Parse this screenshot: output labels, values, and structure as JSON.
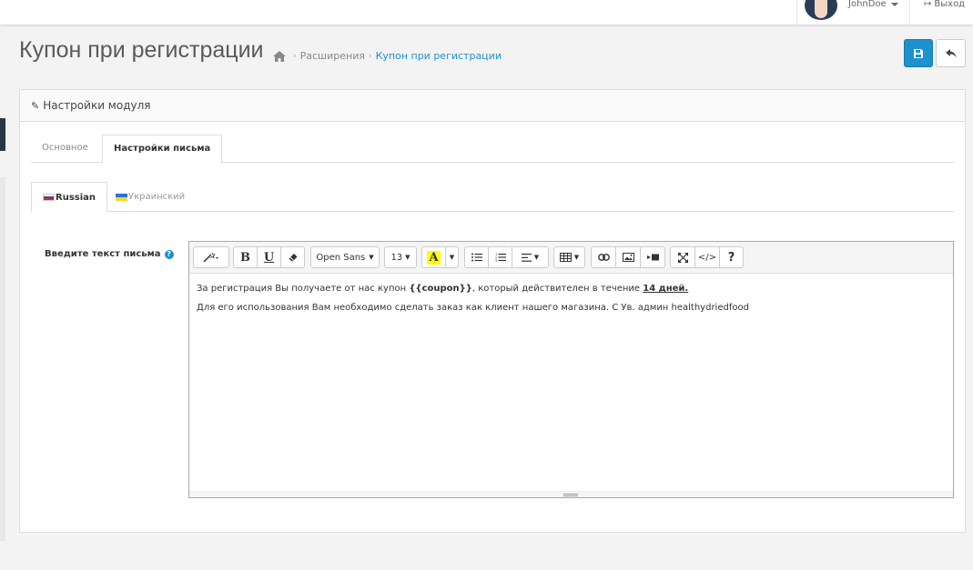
{
  "topbar": {
    "username": "JohnDoe",
    "logout_label": "Выход"
  },
  "header": {
    "title": "Купон при регистрации",
    "breadcrumb": [
      "Расширения",
      "Купон при регистрации"
    ]
  },
  "panel": {
    "heading": "Настройки модуля",
    "tabs": [
      "Основное",
      "Настройки письма"
    ],
    "active_tab": "Настройки письма",
    "language_tabs": [
      "Russian",
      "Украинский"
    ],
    "active_language": "Russian"
  },
  "form": {
    "label": "Введите текст письма",
    "help_icon": "question-circle-icon"
  },
  "editor": {
    "font_family": "Open Sans",
    "font_size": "13",
    "line1_part1": "За регистрация Вы получаете от нас купон ",
    "line1_coupon": "{{coupon}}",
    "line1_part2": ", который действителен в течение ",
    "line1_days": "14 дней.",
    "line2": "Для его использования Вам необходимо сделать заказ как клиент нашего магазина. С Ув. админ healthydriedfood",
    "help_button": "?"
  },
  "colors": {
    "primary": "#1e91cf",
    "highlight": "#ffff00"
  }
}
